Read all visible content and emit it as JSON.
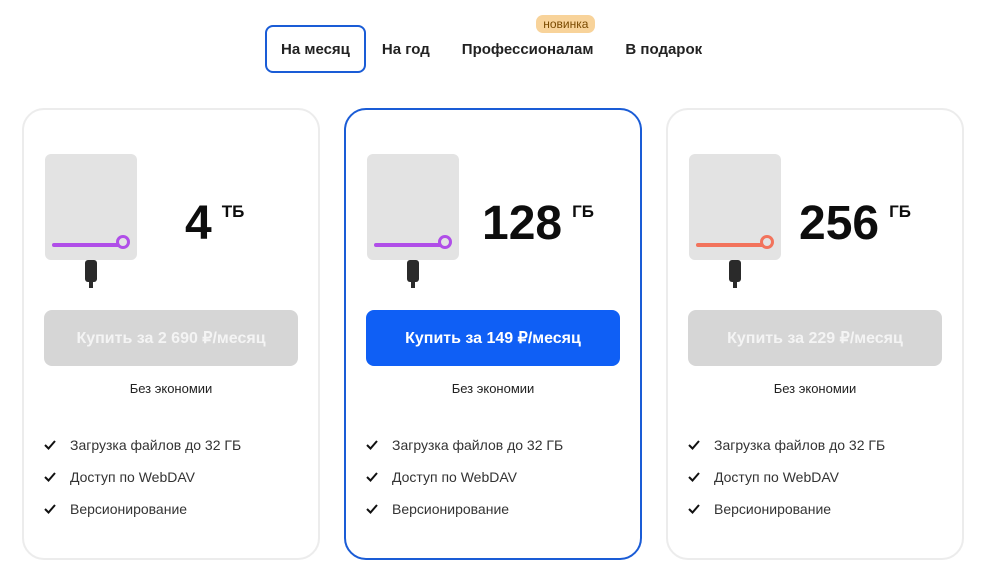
{
  "tabs": {
    "monthly": "На месяц",
    "yearly": "На год",
    "pro": "Профессионалам",
    "pro_badge": "новинка",
    "gift": "В подарок"
  },
  "plans": [
    {
      "size": "4",
      "unit": "ТБ",
      "buy_label": "Купить за  2 690 ₽/месяц",
      "saving": "Без экономии",
      "accent_color": "#b04ee8",
      "features": [
        "Загрузка файлов до 32 ГБ",
        "Доступ по WebDAV",
        "Версионирование"
      ]
    },
    {
      "size": "128",
      "unit": "ГБ",
      "buy_label": "Купить за  149 ₽/месяц",
      "saving": "Без экономии",
      "accent_color": "#b04ee8",
      "features": [
        "Загрузка файлов до 32 ГБ",
        "Доступ по WebDAV",
        "Версионирование"
      ]
    },
    {
      "size": "256",
      "unit": "ГБ",
      "buy_label": "Купить за  229 ₽/месяц",
      "saving": "Без экономии",
      "accent_color": "#f2735c",
      "features": [
        "Загрузка файлов до 32 ГБ",
        "Доступ по WebDAV",
        "Версионирование"
      ]
    }
  ],
  "colors": {
    "brand_blue": "#0f5ff5",
    "selected_border": "#1a5cd6",
    "badge_bg": "#f8d39a"
  },
  "icons": {
    "check": "check-icon",
    "device": "storage-device-icon"
  }
}
